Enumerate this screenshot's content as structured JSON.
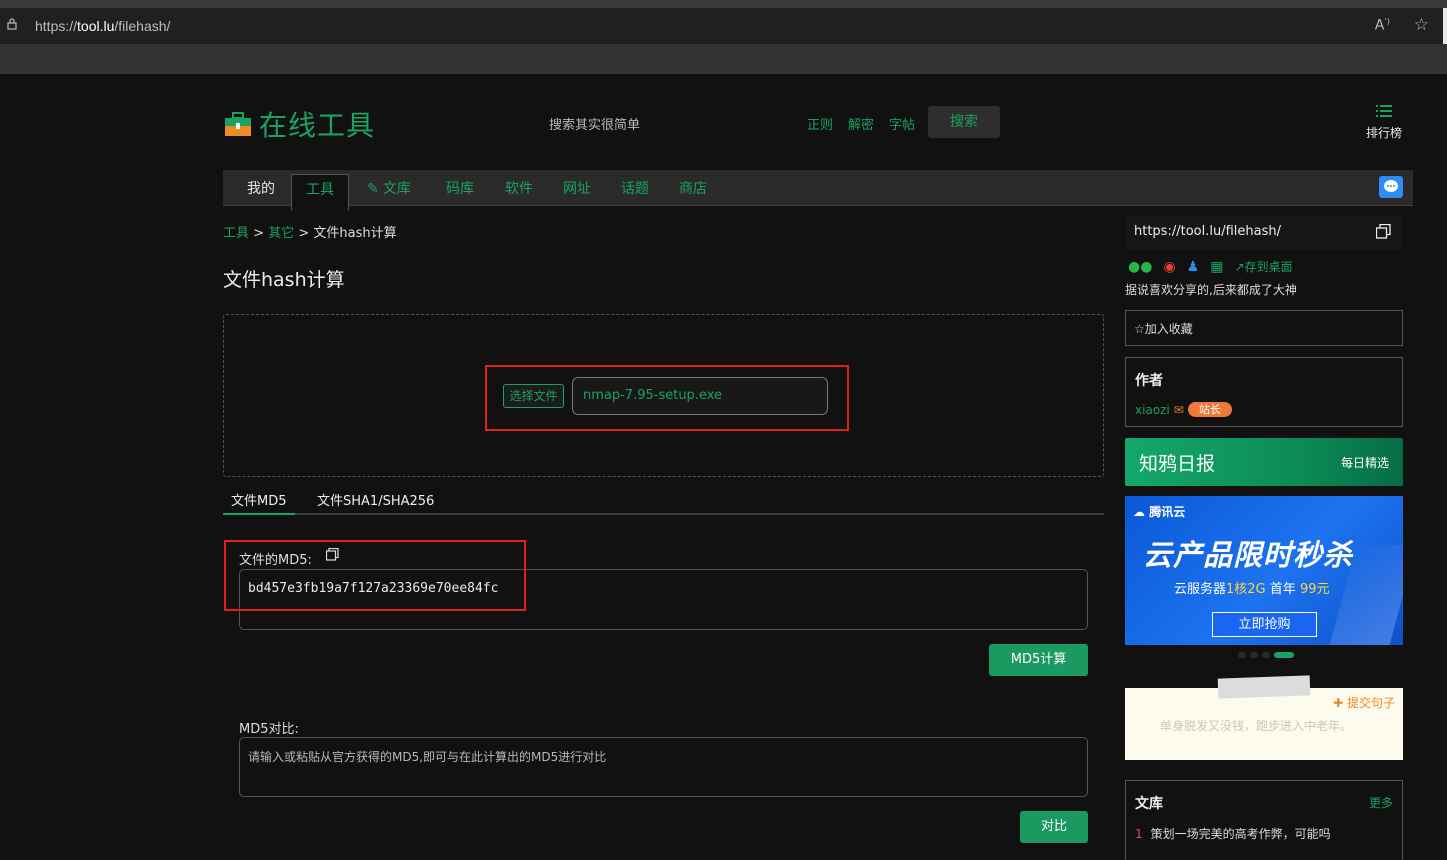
{
  "browser": {
    "url_prefix": "https://",
    "url_host": "tool.lu",
    "url_path": "/filehash/",
    "read_aloud_icon": "Á"
  },
  "header": {
    "logo_text": "在线工具",
    "search_placeholder": "搜索其实很简单",
    "quick_links": [
      "正则",
      "解密",
      "字帖"
    ],
    "search_button": "搜索",
    "rank_label": "排行榜"
  },
  "nav": {
    "items": [
      "我的",
      "工具",
      "文库",
      "码库",
      "软件",
      "网址",
      "话题",
      "商店"
    ],
    "active": "工具"
  },
  "breadcrumb": {
    "root": "工具",
    "sep": ">",
    "parent": "其它",
    "current": "文件hash计算"
  },
  "page_title": "文件hash计算",
  "upload": {
    "choose_button": "选择文件",
    "file_name": "nmap-7.95-setup.exe"
  },
  "tabs": [
    "文件MD5",
    "文件SHA1/SHA256"
  ],
  "md5": {
    "label": "文件的MD5:",
    "value": "bd457e3fb19a7f127a23369e70ee84fc",
    "calc_button": "MD5计算"
  },
  "compare": {
    "label": "MD5对比:",
    "placeholder": "请输入或粘贴从官方获得的MD5,即可与在此计算出的MD5进行对比",
    "button": "对比"
  },
  "sidebar": {
    "share_url": "https://tool.lu/filehash/",
    "save_desktop": "存到桌面",
    "share_tip": "据说喜欢分享的,后来都成了大神",
    "favorite": "加入收藏",
    "author_title": "作者",
    "author_name": "xiaozi",
    "author_badge": "站长",
    "zhiya_title": "知鸦日报",
    "zhiya_sub": "每日精选",
    "ad": {
      "brand": "腾讯云",
      "title": "云产品限时秒杀",
      "sub_pre": "云服务器",
      "sub_hl1": "1核2G",
      "sub_mid": "首年",
      "sub_hl2": "99元",
      "button": "立即抢购"
    },
    "quote_submit": "提交句子",
    "quote": "单身脱发又没钱，跑步进入中老年。",
    "wenku_title": "文库",
    "wenku_more": "更多",
    "wenku_item_1_num": "1",
    "wenku_item_1": "策划一场完美的高考作弊，可能吗"
  },
  "colors": {
    "accent": "#1aa261",
    "background": "#111111",
    "highlight_box": "#e01f1f"
  }
}
